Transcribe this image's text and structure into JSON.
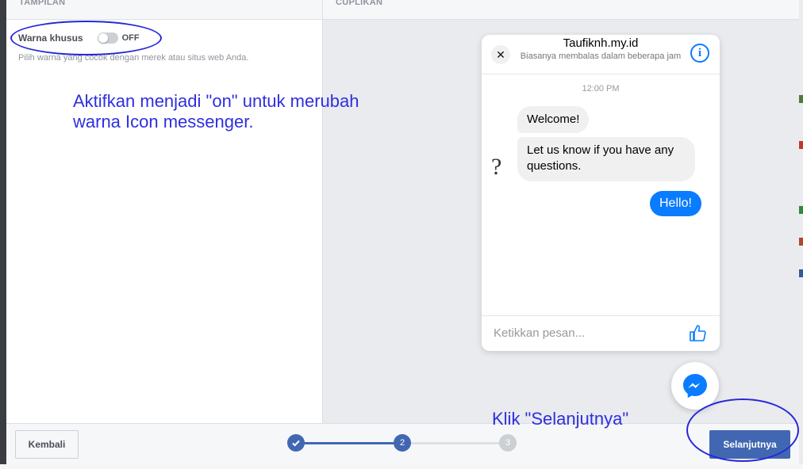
{
  "panels": {
    "left_title": "TAMPILAN",
    "right_title": "CUPLIKAN"
  },
  "setting": {
    "label": "Warna khusus",
    "toggle_state": "OFF",
    "description": "Pilih warna yang cocok dengan merek atau situs web Anda."
  },
  "annotations": {
    "main_line1": "Aktifkan menjadi \"on\" untuk merubah",
    "main_line2": "warna Icon messenger.",
    "next_hint": "Klik \"Selanjutnya\""
  },
  "chat": {
    "title": "Taufiknh.my.id",
    "subtitle": "Biasanya membalas dalam beberapa jam",
    "time": "12:00 PM",
    "msg_welcome": "Welcome!",
    "msg_question": "Let us know if you have any questions.",
    "msg_hello": "Hello!",
    "input_placeholder": "Ketikkan pesan...",
    "accent_color": "#0a7cff"
  },
  "footer": {
    "back_label": "Kembali",
    "next_label": "Selanjutnya",
    "steps": [
      "1",
      "2",
      "3"
    ],
    "current_step": 2,
    "accent_color": "#4267b2"
  },
  "icons": [
    "close-icon",
    "info-icon",
    "like-icon",
    "messenger-icon",
    "check-icon"
  ]
}
